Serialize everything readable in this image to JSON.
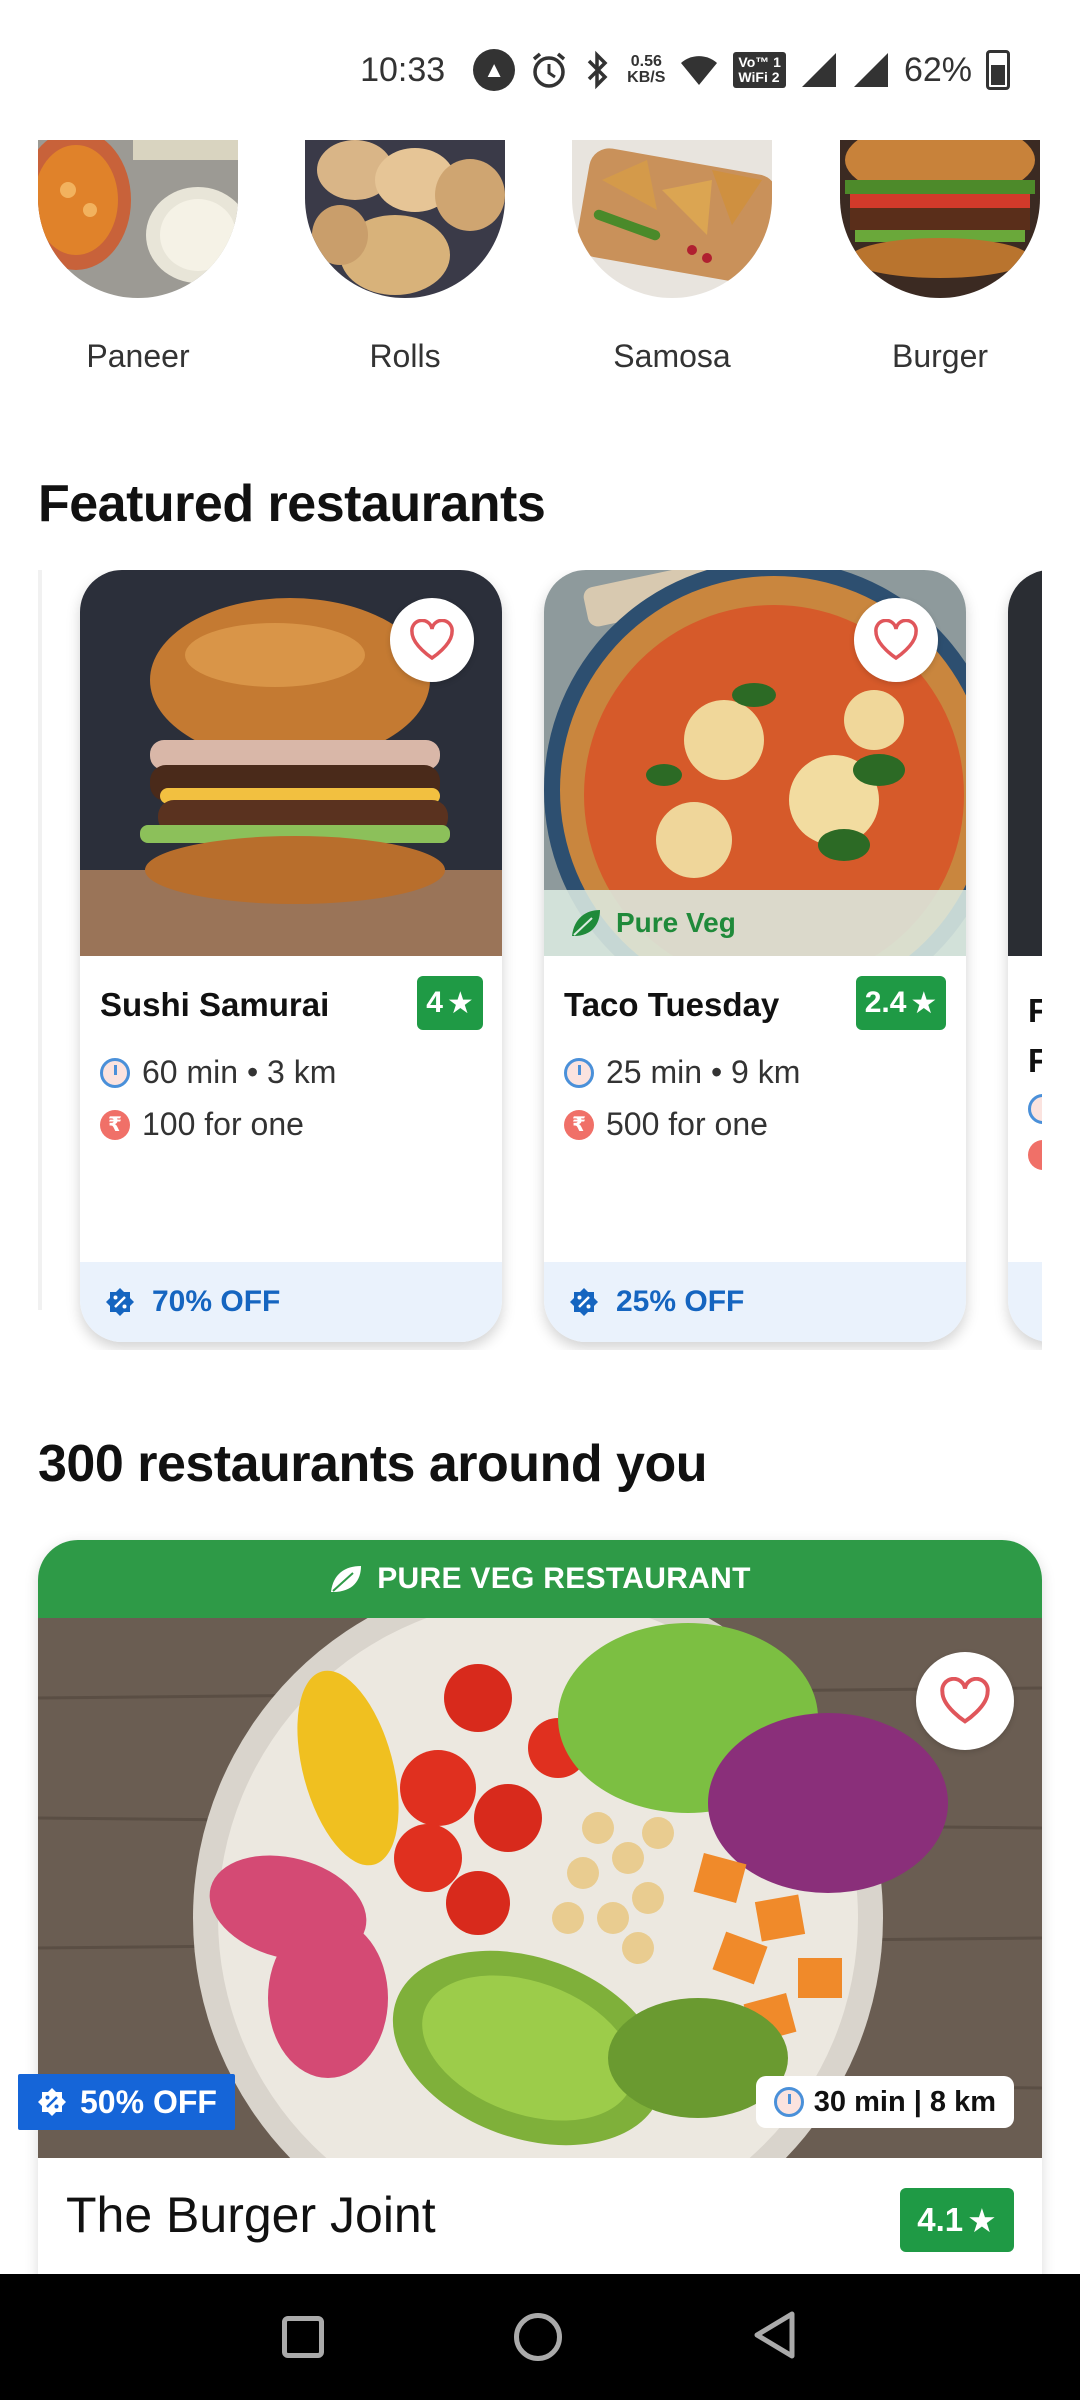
{
  "status_bar": {
    "time": "10:33",
    "net_speed_value": "0.56",
    "net_speed_unit": "KB/S",
    "volte_label_1": "Vo™ 1",
    "volte_label_2": "WiFi 2",
    "battery_percent": "62%",
    "icons": [
      "app-notification-icon",
      "alarm-icon",
      "bluetooth-icon",
      "wifi-icon",
      "signal-icon",
      "battery-icon"
    ]
  },
  "categories": [
    {
      "label": "Paneer",
      "icon": "paneer-image"
    },
    {
      "label": "Rolls",
      "icon": "rolls-image"
    },
    {
      "label": "Samosa",
      "icon": "samosa-image"
    },
    {
      "label": "Burger",
      "icon": "burger-image"
    }
  ],
  "featured": {
    "title": "Featured restaurants",
    "cards": [
      {
        "name": "Sushi Samurai",
        "rating": "4",
        "time_distance": "60 min • 3 km",
        "price": "100 for one",
        "offer": "70% OFF",
        "veg_label": ""
      },
      {
        "name": "Taco Tuesday",
        "rating": "2.4",
        "time_distance": "25 min • 9 km",
        "price": "500 for one",
        "offer": "25% OFF",
        "veg_label": "Pure Veg"
      },
      {
        "name": "F",
        "name_line2": "F"
      }
    ]
  },
  "nearby": {
    "title": "300 restaurants around you",
    "card": {
      "banner": "PURE VEG RESTAURANT",
      "discount": "50% OFF",
      "time_distance": "30 min | 8 km",
      "name": "The Burger Joint",
      "rating": "4.1"
    }
  },
  "colors": {
    "rating_green": "#1f9a45",
    "veg_green": "#2e9a47",
    "offer_blue": "#1565c0",
    "heart_red": "#e0565b"
  }
}
